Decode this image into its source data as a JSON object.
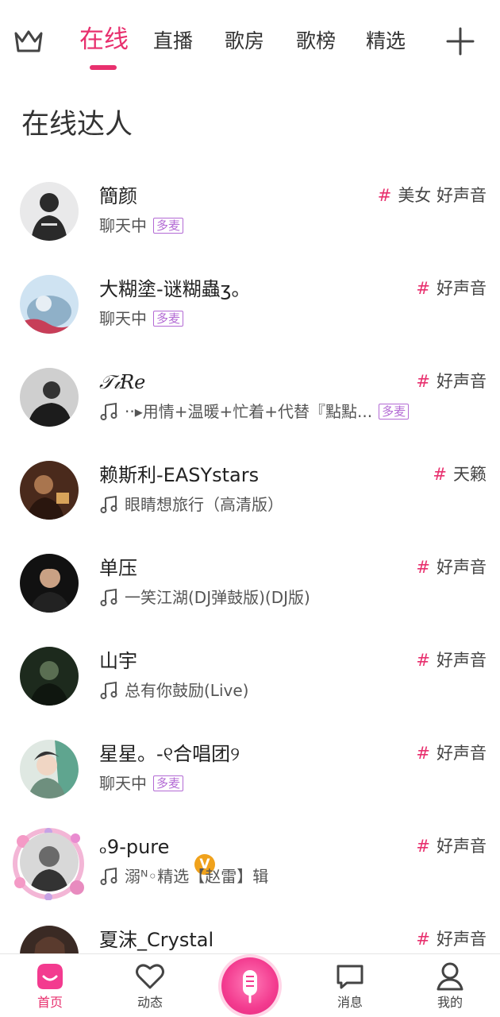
{
  "top_nav": {
    "tabs": [
      {
        "label": "在线",
        "active": true
      },
      {
        "label": "直播"
      },
      {
        "label": "歌房"
      },
      {
        "label": "歌榜"
      },
      {
        "label": "精选"
      }
    ],
    "left_icon": "crown-icon",
    "right_icon": "plus-icon"
  },
  "section": {
    "title": "在线达人"
  },
  "users": [
    {
      "name": "簡颜",
      "status": "聊天中",
      "badge": "多麦",
      "tags": "美女 好声音",
      "status_type": "chat"
    },
    {
      "name": "大糊塗-谜糊蟲ʒ。",
      "status": "聊天中",
      "badge": "多麦",
      "tags": "好声音",
      "status_type": "chat"
    },
    {
      "name": "𝒯𝒾𝑅𝑒",
      "status": "··▸用情+温暖+忙着+代替『點點...",
      "badge": "多麦",
      "tags": "好声音",
      "status_type": "music"
    },
    {
      "name": "赖斯利-EASYstars",
      "status": "眼睛想旅行（高清版）",
      "tags": "天籁",
      "status_type": "music"
    },
    {
      "name": "单压",
      "status": "一笑江湖(DJ弹鼓版)(DJ版)",
      "tags": "好声音",
      "status_type": "music"
    },
    {
      "name": "山宇",
      "status": "总有你鼓励(Live)",
      "tags": "好声音",
      "status_type": "music"
    },
    {
      "name": "星星。-୧合唱团୨",
      "status": "聊天中",
      "badge": "多麦",
      "tags": "好声音",
      "status_type": "chat"
    },
    {
      "name": "ₒ9-pure",
      "status": "溺ᴺ◦精选【赵雷】辑",
      "tags": "好声音",
      "status_type": "music",
      "verified_mark": "V"
    },
    {
      "name": "夏沫_Crystal",
      "tags": "好声音"
    }
  ],
  "bottom_nav": {
    "items": [
      {
        "label": "首页",
        "active": true
      },
      {
        "label": "动态"
      },
      {
        "label": "消息"
      },
      {
        "label": "我的"
      }
    ]
  },
  "colors": {
    "accent": "#e8306e",
    "badge_purple": "#b36ad4",
    "verified_orange": "#f0a21c"
  }
}
